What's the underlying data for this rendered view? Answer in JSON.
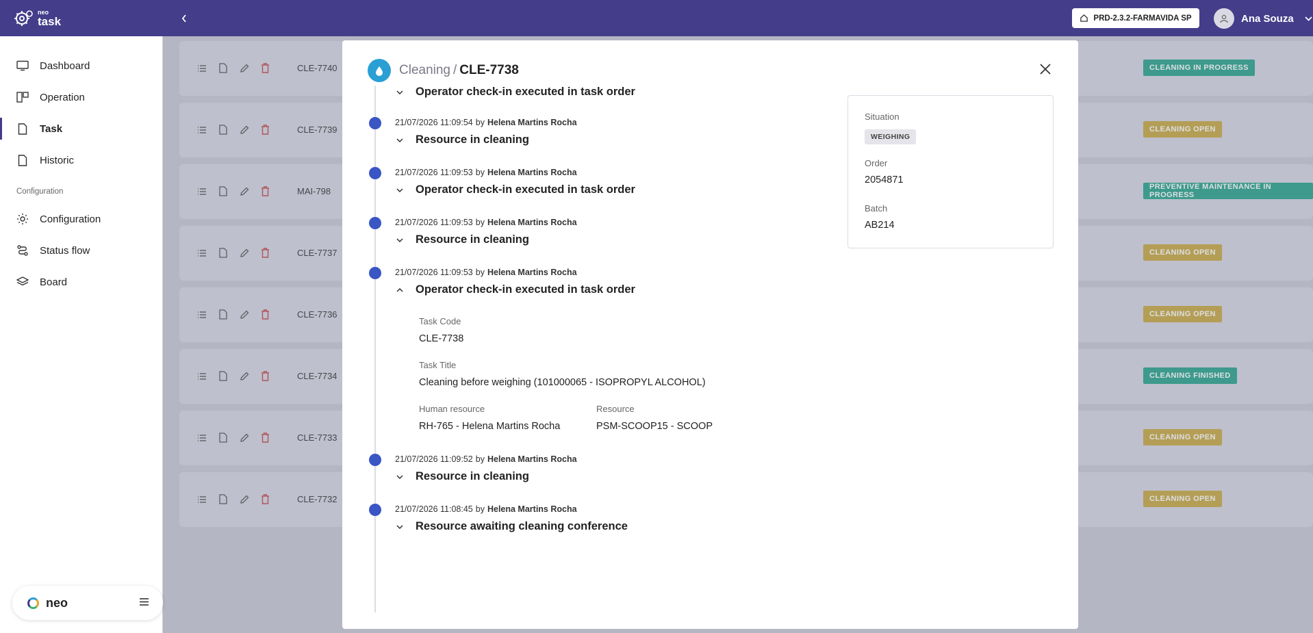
{
  "topbar": {
    "logo_small": "neo",
    "logo_big": "task",
    "collapse_icon": "chevron-left-icon",
    "environment": "PRD-2.3.2-FARMAVIDA SP",
    "user_name": "Ana Souza"
  },
  "sidebar": {
    "items": [
      {
        "label": "Dashboard",
        "icon": "monitor-icon"
      },
      {
        "label": "Operation",
        "icon": "columns-icon"
      },
      {
        "label": "Task",
        "icon": "file-icon",
        "active": true
      },
      {
        "label": "Historic",
        "icon": "file-icon"
      }
    ],
    "section_label": "Configuration",
    "config_items": [
      {
        "label": "Configuration",
        "icon": "sun-icon"
      },
      {
        "label": "Status flow",
        "icon": "route-icon"
      },
      {
        "label": "Board",
        "icon": "layers-icon"
      }
    ],
    "brand": "neo"
  },
  "list": {
    "rows": [
      {
        "code": "CLE-7740",
        "status": "CLEANING IN PROGRESS",
        "color": "#2aa58c"
      },
      {
        "code": "CLE-7739",
        "status": "CLEANING OPEN",
        "color": "#c8aa44"
      },
      {
        "code": "MAI-798",
        "status": "PREVENTIVE MAINTENANCE IN PROGRESS",
        "color": "#2aa58c"
      },
      {
        "code": "CLE-7737",
        "status": "CLEANING OPEN",
        "color": "#c8aa44"
      },
      {
        "code": "CLE-7736",
        "status": "CLEANING OPEN",
        "color": "#c8aa44"
      },
      {
        "code": "CLE-7734",
        "status": "CLEANING FINISHED",
        "color": "#2aa58c"
      },
      {
        "code": "CLE-7733",
        "status": "CLEANING OPEN",
        "color": "#c8aa44"
      },
      {
        "code": "CLE-7732",
        "status": "CLEANING OPEN",
        "color": "#c8aa44"
      }
    ]
  },
  "modal": {
    "breadcrumb_parent": "Cleaning",
    "breadcrumb_sep": "/",
    "task_code": "CLE-7738",
    "first_title": "Operator check-in executed in task order",
    "by_word": "by",
    "events": [
      {
        "date": "21/07/2026 11:09:54",
        "user": "Helena Martins Rocha",
        "title": "Resource in cleaning"
      },
      {
        "date": "21/07/2026 11:09:53",
        "user": "Helena Martins Rocha",
        "title": "Operator check-in executed in task order"
      },
      {
        "date": "21/07/2026 11:09:53",
        "user": "Helena Martins Rocha",
        "title": "Resource in cleaning"
      },
      {
        "date": "21/07/2026 11:09:53",
        "user": "Helena Martins Rocha",
        "title": "Operator check-in executed in task order",
        "expanded": true
      },
      {
        "date": "21/07/2026 11:09:52",
        "user": "Helena Martins Rocha",
        "title": "Resource in cleaning"
      },
      {
        "date": "21/07/2026 11:08:45",
        "user": "Helena Martins Rocha",
        "title": "Resource awaiting cleaning conference"
      }
    ],
    "details": {
      "task_code_label": "Task Code",
      "task_code_value": "CLE-7738",
      "task_title_label": "Task Title",
      "task_title_value": "Cleaning before weighing (101000065 - ISOPROPYL ALCOHOL)",
      "human_resource_label": "Human resource",
      "human_resource_value": "RH-765 - Helena Martins Rocha",
      "resource_label": "Resource",
      "resource_value": "PSM-SCOOP15 - SCOOP"
    },
    "info": {
      "situation_label": "Situation",
      "situation_value": "WEIGHING",
      "order_label": "Order",
      "order_value": "2054871",
      "batch_label": "Batch",
      "batch_value": "AB214"
    }
  }
}
